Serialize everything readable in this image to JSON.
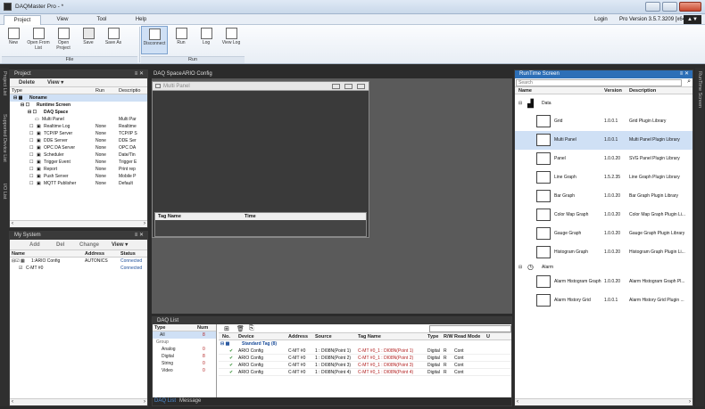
{
  "window": {
    "title": "DAQMaster Pro - *"
  },
  "menu": {
    "tabs": [
      "Project",
      "View",
      "Tool",
      "Help"
    ],
    "login": "Login",
    "version": "Pro Version 3.5.7.3209 [x64]"
  },
  "ribbon": {
    "file_buttons": [
      "New",
      "Open From List",
      "Open Project",
      "Save",
      "Save As"
    ],
    "run_buttons": [
      "Disconnect",
      "Run",
      "Log",
      "View Log"
    ],
    "group_file": "File",
    "group_run": "Run"
  },
  "side_tabs_left": [
    "Project List",
    "Supported Device List",
    "I/O List"
  ],
  "side_tabs_right": [
    "RunTime Screen"
  ],
  "project_panel": {
    "title": "Project",
    "pin": "≡ ✕",
    "toolbar": [
      "Delete",
      "View ▾"
    ],
    "columns": [
      "Type",
      "Run",
      "Descriptio"
    ],
    "root": "Noname",
    "runtime_screen": "Runtime Screen",
    "daq_space": "DAQ Space",
    "multi_panel": {
      "name": "Multi Panel",
      "desc": "Multi Par"
    },
    "items": [
      {
        "name": "Realtime Log",
        "run": "None",
        "desc": "Realtime"
      },
      {
        "name": "TCP/IP Server",
        "run": "None",
        "desc": "TCP/IP S"
      },
      {
        "name": "DDE Server",
        "run": "None",
        "desc": "DDE Ser"
      },
      {
        "name": "OPC DA Server",
        "run": "None",
        "desc": "OPC DA"
      },
      {
        "name": "Scheduler",
        "run": "None",
        "desc": "Date/Tin"
      },
      {
        "name": "Trigger Event",
        "run": "None",
        "desc": "Trigger E"
      },
      {
        "name": "Report",
        "run": "None",
        "desc": "Print rep"
      },
      {
        "name": "Push Server",
        "run": "None",
        "desc": "Mobile P"
      },
      {
        "name": "MQTT Publisher",
        "run": "None",
        "desc": "Default"
      }
    ]
  },
  "system_panel": {
    "title": "My System",
    "toolbar": [
      "Add",
      "Del",
      "Change",
      "View ▾"
    ],
    "columns": [
      "Name",
      "Address",
      "Status"
    ],
    "rows": [
      {
        "name": "1:ARIO Config",
        "address": "AUTONICS",
        "status": "Connected"
      },
      {
        "name": "C-MT #0",
        "address": "",
        "status": "Connected"
      }
    ]
  },
  "doc_tabs": [
    "DAQ Space",
    "ARIO Config"
  ],
  "multi_panel_window": {
    "title": "Multi Panel",
    "columns": [
      "Tag Name",
      "Time"
    ]
  },
  "daq_list": {
    "title": "DAQ List",
    "type_columns": [
      "Type",
      "Num"
    ],
    "types": [
      {
        "name": "All",
        "num": "8"
      },
      {
        "name": "Group",
        "num": ""
      },
      {
        "name": "Analog",
        "num": "0"
      },
      {
        "name": "Digital",
        "num": "8"
      },
      {
        "name": "String",
        "num": "0"
      },
      {
        "name": "Video",
        "num": "0"
      }
    ],
    "columns": [
      "No.",
      "Device",
      "Address",
      "Source",
      "Tag Name",
      "Type",
      "R/W",
      "Read Mode",
      "U"
    ],
    "group": "Standard Tag (8)",
    "rows": [
      {
        "device": "ARIO Config",
        "address": "C-MT #0",
        "source": "1 : DI08N(Point 1)",
        "tag": "C-MT #0_1 : DI08N(Point 1)",
        "type": "Digital",
        "rw": "R",
        "mode": "Cont"
      },
      {
        "device": "ARIO Config",
        "address": "C-MT #0",
        "source": "1 : DI08N(Point 2)",
        "tag": "C-MT #0_1 : DI08N(Point 2)",
        "type": "Digital",
        "rw": "R",
        "mode": "Cont"
      },
      {
        "device": "ARIO Config",
        "address": "C-MT #0",
        "source": "1 : DI08N(Point 3)",
        "tag": "C-MT #0_1 : DI08N(Point 3)",
        "type": "Digital",
        "rw": "R",
        "mode": "Cont"
      },
      {
        "device": "ARIO Config",
        "address": "C-MT #0",
        "source": "1 : DI08N(Point 4)",
        "tag": "C-MT #0_1 : DI08N(Point 4)",
        "type": "Digital",
        "rw": "R",
        "mode": "Cont"
      }
    ],
    "bottom_tabs": [
      "DAQ List",
      "Message"
    ]
  },
  "runtime_panel": {
    "title": "RunTime Screen",
    "pin": "≡ ✕",
    "search_placeholder": "Search",
    "columns": [
      "Name",
      "Version",
      "Description"
    ],
    "data_group": "Data",
    "data_items": [
      {
        "name": "Grid",
        "version": "1.0.0.1",
        "desc": "Grid Plugin Library"
      },
      {
        "name": "Multi Panel",
        "version": "1.0.0.1",
        "desc": "Multi Panel Plugin Library"
      },
      {
        "name": "Panel",
        "version": "1.0.0.20",
        "desc": "SVG Panel Plugin Library"
      },
      {
        "name": "Line Graph",
        "version": "1.5.2.35",
        "desc": "Line Graph Plugin Library"
      },
      {
        "name": "Bar Graph",
        "version": "1.0.0.20",
        "desc": "Bar Graph Plugin Library"
      },
      {
        "name": "Color Map Graph",
        "version": "1.0.0.20",
        "desc": "Color Map Graph Plugin Li..."
      },
      {
        "name": "Gauge Graph",
        "version": "1.0.0.20",
        "desc": "Gauge Graph Plugin Library"
      },
      {
        "name": "Histogram Graph",
        "version": "1.0.0.20",
        "desc": "Histogram Graph Plugin Li..."
      }
    ],
    "alarm_group": "Alarm",
    "alarm_items": [
      {
        "name": "Alarm Histogram Graph",
        "version": "1.0.0.20",
        "desc": "Alarm Histogram Graph Pl..."
      },
      {
        "name": "Alarm History Grid",
        "version": "1.0.0.1",
        "desc": "Alarm History Grid Plugin ..."
      }
    ]
  },
  "colors": {
    "accent": "#2d6fb7",
    "selected": "#cfe0f5",
    "dark_bg": "#2b2b2b",
    "tag_red": "#b22222"
  }
}
